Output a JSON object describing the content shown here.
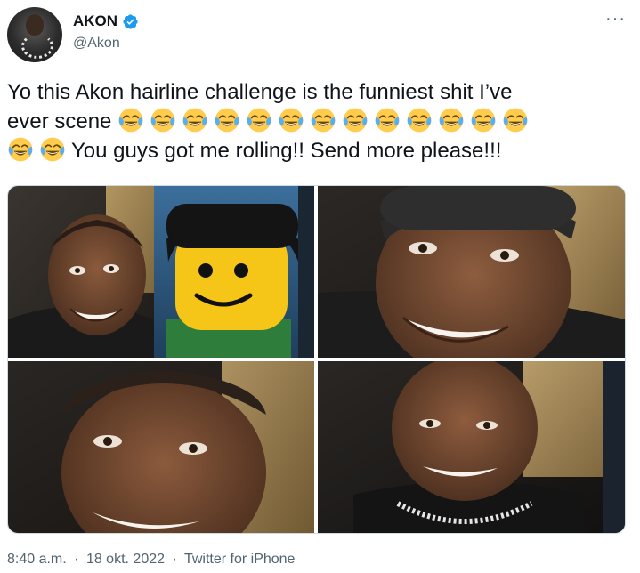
{
  "author": {
    "display_name": "AKON",
    "handle": "@Akon",
    "verified_color": "#1d9bf0"
  },
  "menu": {
    "more_label": "···"
  },
  "tweet": {
    "text_line1": "Yo this Akon hairline challenge is the funniest shit I’ve",
    "text_line2_prefix": "ever scene",
    "text_line3_suffix": "You guys got me rolling!!  Send more please!!!",
    "emoji_name": "face-with-tears-of-joy-icon",
    "emoji_count_line2": 13,
    "emoji_count_line3": 2
  },
  "media": {
    "images": [
      {
        "name": "photo-akon-with-lego-figure"
      },
      {
        "name": "photo-akon-closeup-smile"
      },
      {
        "name": "photo-akon-closeup-wide"
      },
      {
        "name": "photo-akon-smile-chain"
      }
    ]
  },
  "meta": {
    "time": "8:40 a.m.",
    "separator": "·",
    "date": "18 okt. 2022",
    "source": "Twitter for iPhone"
  },
  "colors": {
    "text": "#0f1419",
    "secondary": "#536471",
    "border": "#cfd9de",
    "verified": "#1d9bf0"
  }
}
